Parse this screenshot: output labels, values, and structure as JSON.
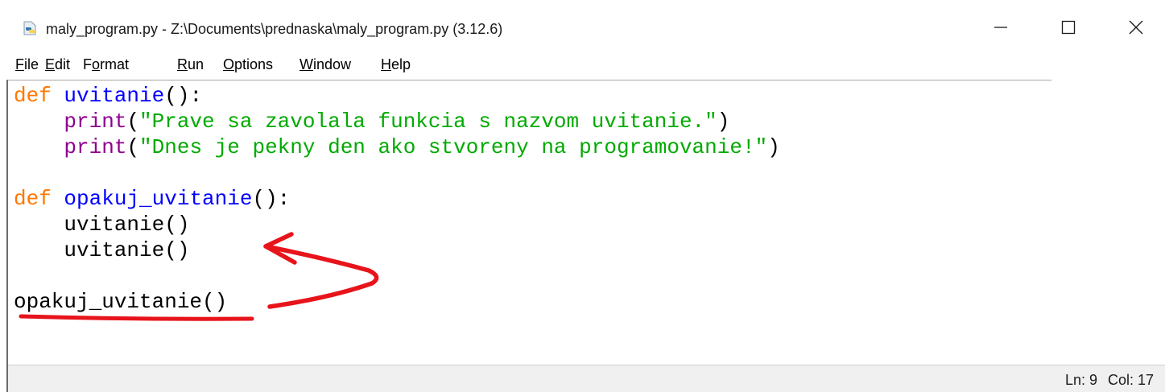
{
  "window": {
    "title": "maly_program.py - Z:\\Documents\\prednaska\\maly_program.py (3.12.6)",
    "icon": "python-file-icon",
    "controls": {
      "minimize": "minimize-icon",
      "maximize": "maximize-icon",
      "close": "close-icon"
    }
  },
  "menu": {
    "items": [
      {
        "pre": "",
        "u": "F",
        "post": "ile"
      },
      {
        "pre": "",
        "u": "E",
        "post": "dit"
      },
      {
        "pre": "F",
        "u": "o",
        "post": "rmat"
      },
      {
        "pre": "",
        "u": "R",
        "post": "un"
      },
      {
        "pre": "",
        "u": "O",
        "post": "ptions"
      },
      {
        "pre": "",
        "u": "W",
        "post": "indow"
      },
      {
        "pre": "",
        "u": "H",
        "post": "elp"
      }
    ]
  },
  "code": {
    "lines": [
      {
        "kw": "def",
        "name": "uvitanie",
        "rest": "():"
      },
      {
        "indent": "    ",
        "builtin": "print",
        "open": "(",
        "str": "\"Prave sa zavolala funkcia s nazvom uvitanie.\"",
        "close": ")"
      },
      {
        "indent": "    ",
        "builtin": "print",
        "open": "(",
        "str": "\"Dnes je pekny den ako stvoreny na programovanie!\"",
        "close": ")"
      },
      {
        "kw": "def",
        "name": "opakuj_uvitanie",
        "rest": "():"
      },
      {
        "text": "    uvitanie()"
      },
      {
        "text": "    uvitanie()"
      },
      {
        "text": "opakuj_uvitanie()"
      }
    ]
  },
  "colors": {
    "keyword": "#ff7700",
    "definition": "#0000ff",
    "builtin": "#900090",
    "string": "#00aa00",
    "annotation": "#e8141b"
  },
  "status": {
    "line": "Ln: 9",
    "col": "Col: 17"
  }
}
